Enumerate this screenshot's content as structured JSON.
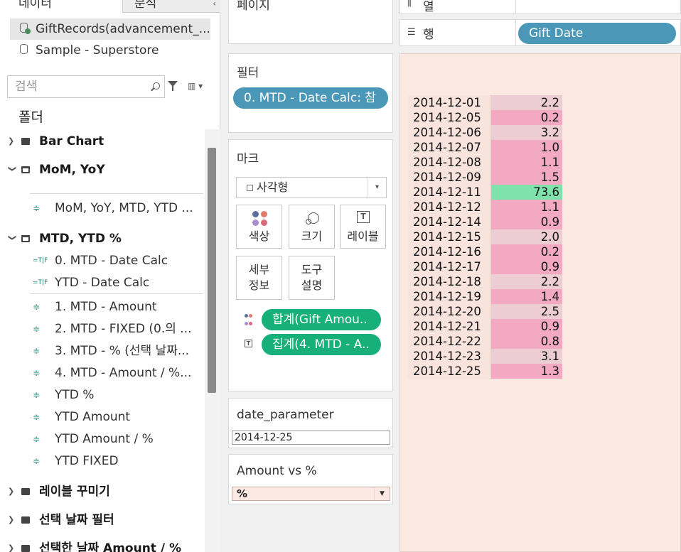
{
  "tabs": {
    "data": "데이터",
    "analysis": "분석",
    "collapse": "‹"
  },
  "sources": [
    {
      "label": "GiftRecords(advancement_...",
      "active": true
    },
    {
      "label": "Sample - Superstore",
      "active": false
    }
  ],
  "search": {
    "placeholder": "검색",
    "view_toggle": "▥ ▾"
  },
  "folder_title": "폴더",
  "tree": {
    "f_bar": "Bar Chart",
    "f_mom": "MoM, YoY",
    "i_mom": "MoM, YoY, MTD, YTD ...",
    "f_mtd": "MTD, YTD %",
    "i_mtd0": "0. MTD - Date Calc",
    "i_ytd_date": "YTD - Date Calc",
    "i_mtd1": "1. MTD - Amount",
    "i_mtd2": "2. MTD - FIXED (0.의 ...",
    "i_mtd3": "3. MTD - % (선택 날짜...",
    "i_mtd4": "4. MTD - Amount / %...",
    "i_ytd_pct": "YTD %",
    "i_ytd_amt": "YTD Amount",
    "i_ytd_amt_pct": "YTD Amount / %",
    "i_ytd_fixed": "YTD FIXED",
    "f_label": "레이블 꾸미기",
    "f_datefilter": "선택 날짜 필터",
    "f_selamount": "선택한 날짜 Amount / %",
    "icon_measure": "≑",
    "icon_bool": "=T|F"
  },
  "cards": {
    "pages": "페이지",
    "filters": "필터",
    "filter_pill": "0. MTD - Date Calc: 참",
    "marks": "마크",
    "mark_type": "사각형",
    "btn_color": "색상",
    "btn_size": "크기",
    "btn_label": "레이블",
    "btn_detail": "세부\n정보",
    "btn_tooltip": "도구\n설명",
    "pill_color": "합계(Gift Amou..",
    "pill_label": "집계(4. MTD - A..",
    "param_date_title": "date_parameter",
    "param_date_value": "2014-12-25",
    "param_amt_title": "Amount vs %",
    "param_amt_value": "%"
  },
  "shelves": {
    "columns_label": "열",
    "rows_label": "행",
    "rows_pill": "Gift Date"
  },
  "colors": {
    "pill_blue": "#4a97b8",
    "pill_green": "#17b07a",
    "cell_low": "#f3a9c2",
    "cell_mid": "#eccdd3",
    "cell_high": "#7ee2ad"
  },
  "chart_data": {
    "type": "table",
    "rows": [
      {
        "date": "2014-12-01",
        "value": "2.2"
      },
      {
        "date": "2014-12-05",
        "value": "0.2"
      },
      {
        "date": "2014-12-06",
        "value": "3.2"
      },
      {
        "date": "2014-12-07",
        "value": "1.0"
      },
      {
        "date": "2014-12-08",
        "value": "1.1"
      },
      {
        "date": "2014-12-09",
        "value": "1.5"
      },
      {
        "date": "2014-12-11",
        "value": "73.6"
      },
      {
        "date": "2014-12-12",
        "value": "1.1"
      },
      {
        "date": "2014-12-14",
        "value": "0.9"
      },
      {
        "date": "2014-12-15",
        "value": "2.0"
      },
      {
        "date": "2014-12-16",
        "value": "0.2"
      },
      {
        "date": "2014-12-17",
        "value": "0.9"
      },
      {
        "date": "2014-12-18",
        "value": "2.2"
      },
      {
        "date": "2014-12-19",
        "value": "1.4"
      },
      {
        "date": "2014-12-20",
        "value": "2.5"
      },
      {
        "date": "2014-12-21",
        "value": "0.9"
      },
      {
        "date": "2014-12-22",
        "value": "0.8"
      },
      {
        "date": "2014-12-23",
        "value": "3.1"
      },
      {
        "date": "2014-12-25",
        "value": "1.3"
      }
    ]
  }
}
